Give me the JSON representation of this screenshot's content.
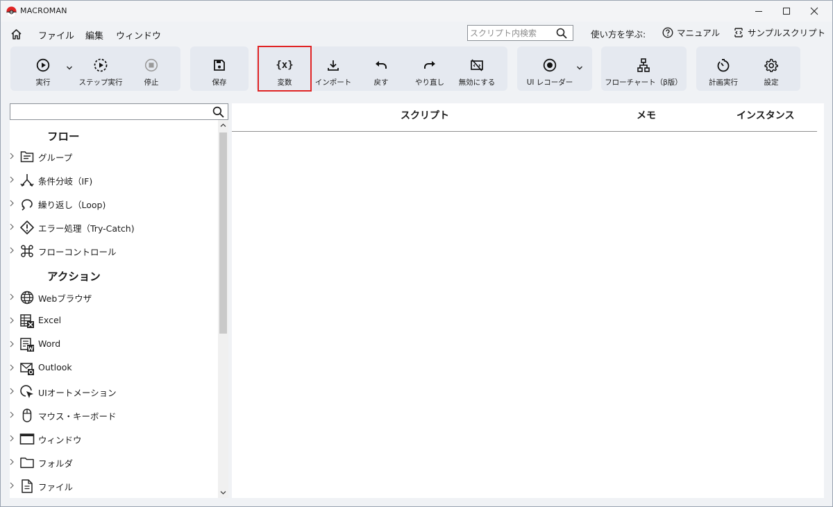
{
  "app": {
    "title": "MACROMAN",
    "brand_color": "#e02424"
  },
  "menu": {
    "items": [
      "ファイル",
      "編集",
      "ウィンドウ"
    ],
    "search_placeholder": "スクリプト内検索",
    "help_label": "使い方を学ぶ:",
    "manual_label": "マニュアル",
    "samples_label": "サンプルスクリプト"
  },
  "toolbar": {
    "run": "実行",
    "step_run": "ステップ実行",
    "stop": "停止",
    "save": "保存",
    "variables": "変数",
    "variables_icon_text": "{x}",
    "import": "インポート",
    "undo": "戻す",
    "redo": "やり直し",
    "disable": "無効にする",
    "ui_recorder": "UI レコーダー",
    "flowchart": "フローチャート（β版）",
    "schedule": "計画実行",
    "settings": "設定",
    "highlighted_button": "variables"
  },
  "sidebar": {
    "search_value": "",
    "flow_header": "フロー",
    "flow_items": [
      {
        "label": "グループ",
        "icon": "group-icon"
      },
      {
        "label": "条件分岐（IF)",
        "icon": "branch-icon"
      },
      {
        "label": "繰り返し（Loop)",
        "icon": "loop-icon"
      },
      {
        "label": "エラー処理（Try-Catch)",
        "icon": "error-icon"
      },
      {
        "label": "フローコントロール",
        "icon": "command-icon"
      }
    ],
    "action_header": "アクション",
    "action_items": [
      {
        "label": "Webブラウザ",
        "icon": "globe-icon"
      },
      {
        "label": "Excel",
        "icon": "excel-icon"
      },
      {
        "label": "Word",
        "icon": "word-icon"
      },
      {
        "label": "Outlook",
        "icon": "outlook-icon"
      },
      {
        "label": "UIオートメーション",
        "icon": "ui-automation-icon"
      },
      {
        "label": "マウス・キーボード",
        "icon": "mouse-icon"
      },
      {
        "label": "ウィンドウ",
        "icon": "window-icon"
      },
      {
        "label": "フォルダ",
        "icon": "folder-icon"
      },
      {
        "label": "ファイル",
        "icon": "file-icon"
      }
    ]
  },
  "script_table": {
    "columns": [
      "スクリプト",
      "メモ",
      "インスタンス"
    ],
    "rows": []
  }
}
